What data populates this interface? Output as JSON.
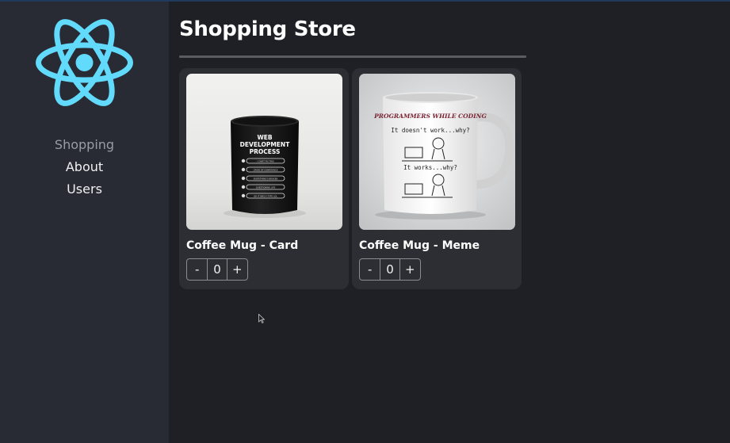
{
  "sidebar": {
    "logo_icon": "react-atom-icon",
    "items": [
      {
        "label": "Shopping",
        "active": true
      },
      {
        "label": "About",
        "active": false
      },
      {
        "label": "Users",
        "active": false
      }
    ]
  },
  "header": {
    "title": "Shopping Store"
  },
  "products": [
    {
      "name": "Coffee Mug - Card",
      "quantity": "0",
      "decrement_label": "-",
      "increment_label": "+",
      "mug_print": {
        "title_lines": [
          "WEB",
          "DEVELOPMENT",
          "PROCESS"
        ],
        "steps": [
          "I CAN'T FIX THIS",
          "CRISIS OF CONFIDENCE",
          "EVERYTHING'S BROKEN",
          "QUESTIONING LIFE",
          "OH IT WAS A TYPO LOL"
        ]
      }
    },
    {
      "name": "Coffee Mug - Meme",
      "quantity": "0",
      "decrement_label": "-",
      "increment_label": "+",
      "mug_print": {
        "title": "PROGRAMMERS WHILE CODING",
        "line1": "It doesn't work...why?",
        "line2": "It works...why?"
      }
    }
  ],
  "colors": {
    "accent": "#61dafb",
    "sidebar_bg": "#282b33",
    "main_bg": "#1e2025",
    "card_bg": "#2c2e33"
  }
}
